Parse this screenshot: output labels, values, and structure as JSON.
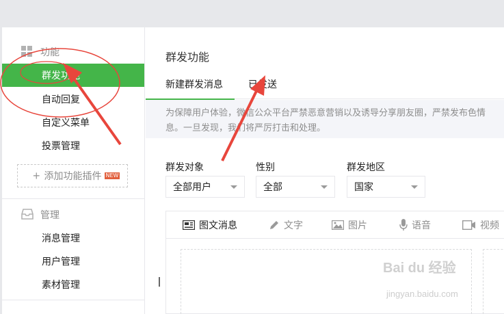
{
  "sidebar": {
    "sections": [
      {
        "title": "功能",
        "icon": "grid-icon"
      },
      {
        "title": "管理",
        "icon": "inbox-icon"
      }
    ],
    "function_items": [
      {
        "label": "群发功能",
        "active": true
      },
      {
        "label": "自动回复"
      },
      {
        "label": "自定义菜单"
      },
      {
        "label": "投票管理"
      }
    ],
    "add_plugin": {
      "label": "添加功能插件",
      "badge": "NEW"
    },
    "manage_items": [
      {
        "label": "消息管理"
      },
      {
        "label": "用户管理"
      },
      {
        "label": "素材管理"
      }
    ]
  },
  "main": {
    "title": "群发功能",
    "tabs": [
      {
        "label": "新建群发消息",
        "active": true
      },
      {
        "label": "已发送"
      }
    ],
    "notice": {
      "line1": "为保障用户体验，微信公众平台严禁恶意营销以及诱导分享朋友圈，严禁发布色情",
      "line2": "息。一旦发现，我们将严厉打击和处理。"
    },
    "filters": {
      "target": {
        "label": "群发对象",
        "value": "全部用户"
      },
      "gender": {
        "label": "性别",
        "value": "全部"
      },
      "region": {
        "label": "群发地区",
        "value": "国家"
      }
    },
    "editor_tabs": [
      {
        "label": "图文消息",
        "icon": "news-icon",
        "active": true
      },
      {
        "label": "文字",
        "icon": "pencil-icon"
      },
      {
        "label": "图片",
        "icon": "image-icon"
      },
      {
        "label": "语音",
        "icon": "microphone-icon"
      },
      {
        "label": "视频",
        "icon": "video-icon"
      }
    ]
  },
  "watermark": {
    "text": "Bai du 经验",
    "sub": "jingyan.baidu.com"
  },
  "colors": {
    "accent": "#44b549",
    "annotation": "#e8463c"
  }
}
